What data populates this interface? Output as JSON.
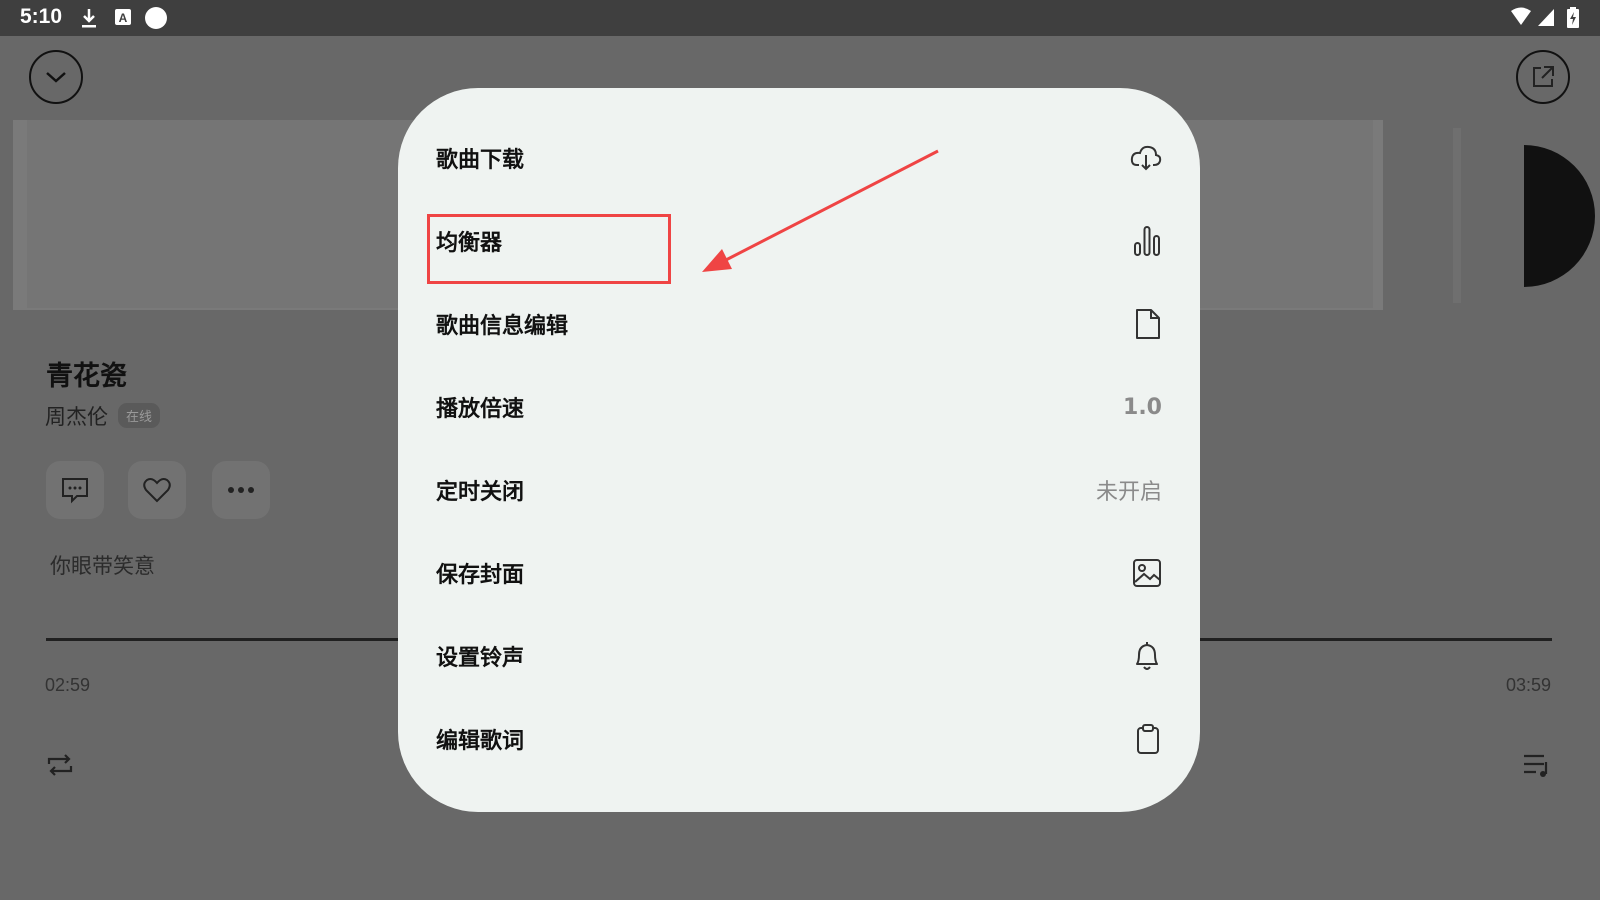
{
  "status_bar": {
    "time": "5:10"
  },
  "player": {
    "song_title": "青花瓷",
    "artist": "周杰伦",
    "badge": "在线",
    "lyric": "你眼带笑意",
    "elapsed": "02:59",
    "duration": "03:59",
    "progress_fraction": 0.75
  },
  "menu": {
    "items": [
      {
        "label": "歌曲下载",
        "icon": "cloud-download-icon"
      },
      {
        "label": "均衡器",
        "icon": "equalizer-icon"
      },
      {
        "label": "歌曲信息编辑",
        "icon": "document-icon"
      },
      {
        "label": "播放倍速",
        "value": "1.0"
      },
      {
        "label": "定时关闭",
        "value": "未开启"
      },
      {
        "label": "保存封面",
        "icon": "image-icon"
      },
      {
        "label": "设置铃声",
        "icon": "bell-icon"
      },
      {
        "label": "编辑歌词",
        "icon": "clipboard-icon"
      }
    ]
  },
  "colors": {
    "overlay": "#686868",
    "dialog": "#eff3f1",
    "highlight": "#ef4444"
  }
}
